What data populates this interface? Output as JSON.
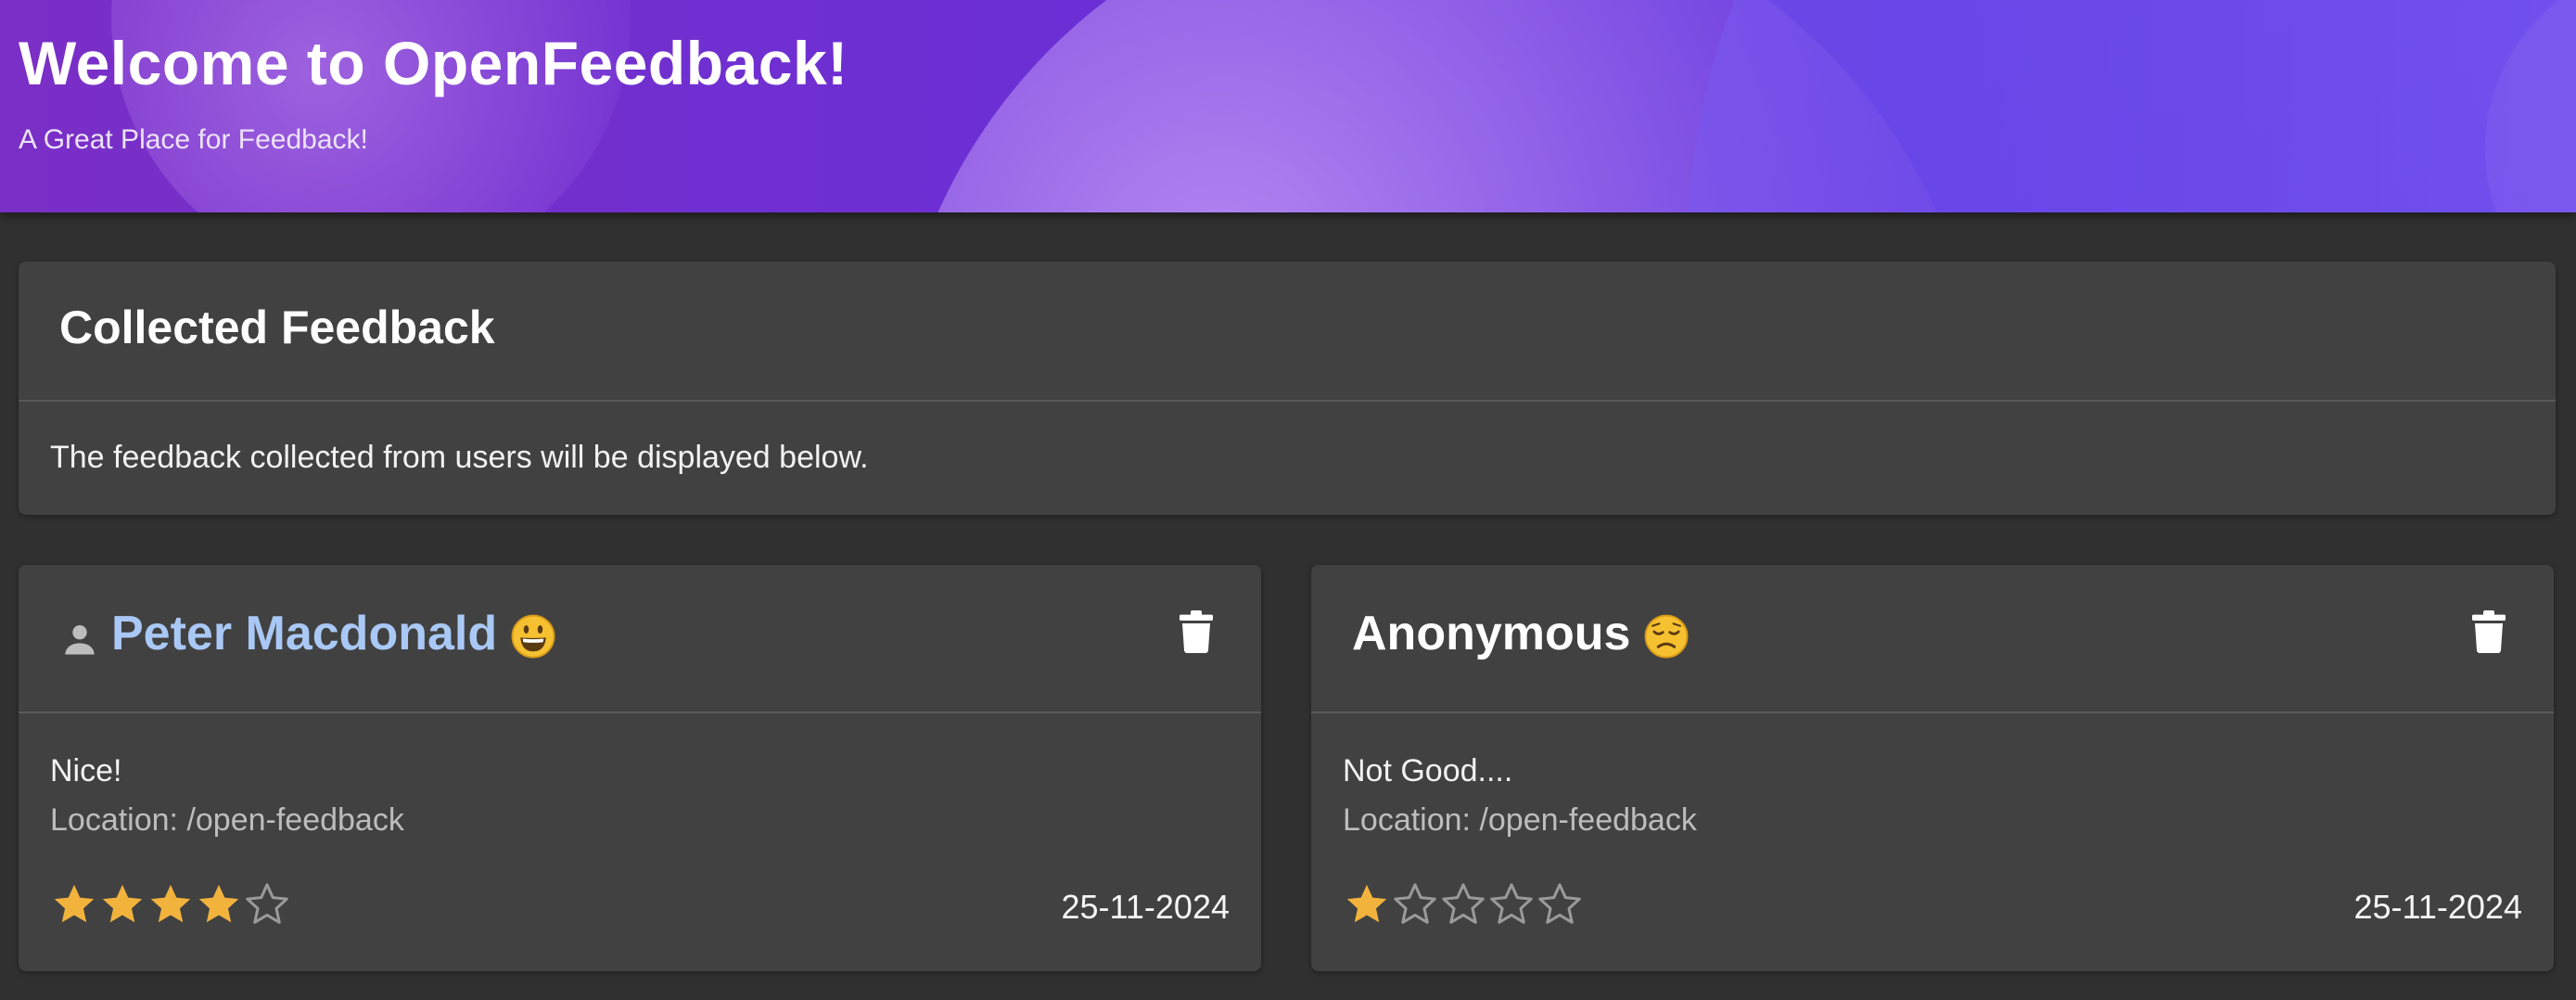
{
  "header": {
    "title": "Welcome to OpenFeedback!",
    "subtitle": "A Great Place for Feedback!"
  },
  "summary": {
    "title": "Collected Feedback",
    "description": "The feedback collected from users will be displayed below."
  },
  "feedback": [
    {
      "author": "Peter Macdonald",
      "has_profile_icon": true,
      "mood": "smiling-face",
      "message": "Nice!",
      "location": "Location: /open-feedback",
      "rating": 4,
      "max_rating": 5,
      "date": "25-11-2024"
    },
    {
      "author": "Anonymous",
      "has_profile_icon": false,
      "mood": "disappointed-face",
      "message": "Not Good....",
      "location": "Location: /open-feedback",
      "rating": 1,
      "max_rating": 5,
      "date": "25-11-2024"
    }
  ],
  "colors": {
    "page_background": "#303030",
    "panel_background": "#414141",
    "header_gradient_start": "#7a2fc6",
    "header_gradient_end": "#6f4ded",
    "author_link": "#a9c8f5",
    "star_filled": "#f2b33d",
    "star_empty": "#9a9a9a"
  },
  "icons": {
    "user": "person-icon",
    "delete": "trash-icon",
    "star": "star-icon"
  }
}
